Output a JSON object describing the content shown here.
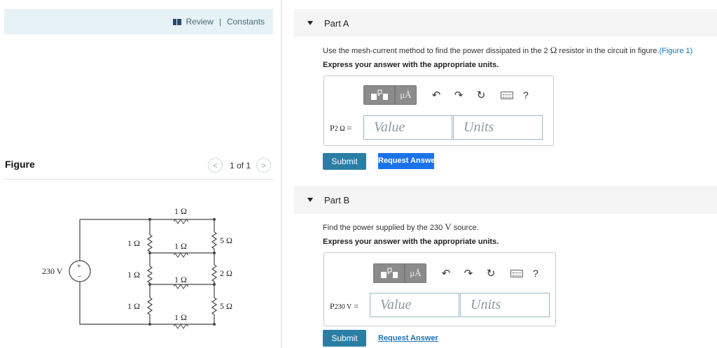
{
  "left": {
    "review_label": "Review",
    "separator": "|",
    "constants_label": "Constants",
    "figure_label": "Figure",
    "pager": {
      "text": "1 of 1",
      "prev": "<",
      "next": ">"
    }
  },
  "circuit": {
    "source": "230 V",
    "top_resistor": "1 Ω",
    "mid1_resistor": "1 Ω",
    "mid2_resistor": "1 Ω",
    "bottom_resistor": "1 Ω",
    "left_r1": "1 Ω",
    "left_r2": "1 Ω",
    "left_r3": "1 Ω",
    "right_r1": "5 Ω",
    "right_r2": "2 Ω",
    "right_r3": "5 Ω",
    "plus": "+",
    "minus": "−"
  },
  "partA": {
    "title": "Part A",
    "question_pre": "Use the mesh-current method to find the power dissipated in the 2 ",
    "question_omega": "Ω",
    "question_post": " resistor in the circuit in figure.",
    "figure_link": "(Figure 1)",
    "instruction": "Express your answer with the appropriate units.",
    "var_main": "P",
    "var_sub": "2 Ω",
    "var_eq": " =",
    "value_placeholder": "Value",
    "units_placeholder": "Units",
    "submit": "Submit",
    "request": "Request Answer"
  },
  "partB": {
    "title": "Part B",
    "question_pre": "Find the power supplied by the 230 ",
    "question_v": "V",
    "question_post": " source.",
    "instruction": "Express your answer with the appropriate units.",
    "var_main": "P",
    "var_sub": "230 V",
    "var_eq": " =",
    "value_placeholder": "Value",
    "units_placeholder": "Units",
    "submit": "Submit",
    "request": "Request Answer"
  },
  "toolbar": {
    "mu_label": "μÅ",
    "undo": "↶",
    "redo": "↷",
    "reset": "↻",
    "help": "?"
  }
}
